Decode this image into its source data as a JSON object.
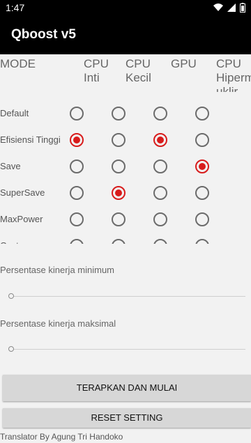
{
  "status_bar": {
    "time": "1:47"
  },
  "app_bar": {
    "title": "Qboost v5"
  },
  "table": {
    "headers": [
      "MODE",
      "CPU\nInti",
      "CPU\nKecil",
      "GPU",
      "CPU\nHiperm\nuklir"
    ],
    "rows": [
      {
        "label": "Default",
        "checked": [
          false,
          false,
          false,
          false
        ]
      },
      {
        "label": "Efisiensi Tinggi",
        "checked": [
          true,
          false,
          true,
          false
        ]
      },
      {
        "label": "Save",
        "checked": [
          false,
          false,
          false,
          true
        ]
      },
      {
        "label": "SuperSave",
        "checked": [
          false,
          true,
          false,
          false
        ]
      },
      {
        "label": "MaxPower",
        "checked": [
          false,
          false,
          false,
          false
        ]
      },
      {
        "label": "Custom",
        "checked": [
          false,
          false,
          false,
          false
        ]
      }
    ]
  },
  "sliders": {
    "min_label": "Persentase kinerja minimum",
    "min_value": 0,
    "max_label": "Persentase kinerja maksimal",
    "max_value": 0
  },
  "buttons": {
    "apply": "TERAPKAN DAN MULAI",
    "reset": "RESET SETTING"
  },
  "footer": "Translator By Agung Tri Handoko",
  "colors": {
    "accent": "#d81b1b",
    "appbar": "#000000",
    "background": "#f2f2f2"
  }
}
